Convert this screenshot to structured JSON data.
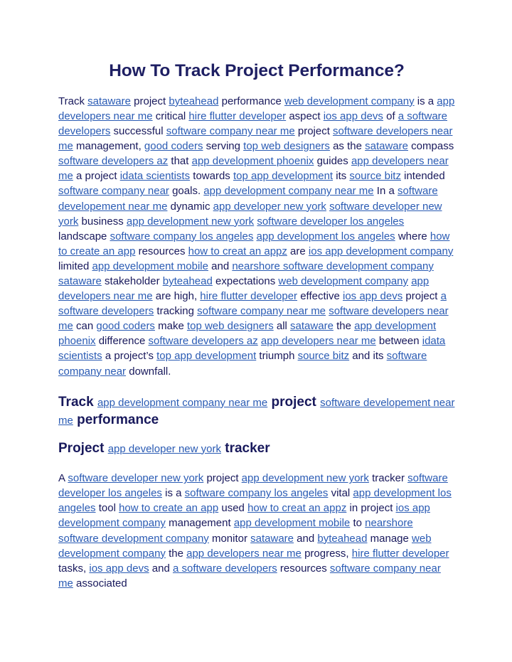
{
  "document": {
    "title": "How To Track Project Performance?",
    "colors": {
      "title": "#1e1f63",
      "body_text": "#18195c",
      "link": "#2a5bb4",
      "background": "#ffffff"
    },
    "paragraph_1": [
      {
        "t": "text",
        "v": "Track "
      },
      {
        "t": "link",
        "v": "sataware"
      },
      {
        "t": "text",
        "v": " project "
      },
      {
        "t": "link",
        "v": "byteahead"
      },
      {
        "t": "text",
        "v": " performance "
      },
      {
        "t": "link",
        "v": "web development company"
      },
      {
        "t": "text",
        "v": " is a "
      },
      {
        "t": "link",
        "v": "app developers near me"
      },
      {
        "t": "text",
        "v": " critical "
      },
      {
        "t": "link",
        "v": "hire flutter developer"
      },
      {
        "t": "text",
        "v": " aspect "
      },
      {
        "t": "link",
        "v": "ios app devs"
      },
      {
        "t": "text",
        "v": " of "
      },
      {
        "t": "link",
        "v": "a software developers"
      },
      {
        "t": "text",
        "v": " successful "
      },
      {
        "t": "link",
        "v": "software company near me"
      },
      {
        "t": "text",
        "v": " project "
      },
      {
        "t": "link",
        "v": "software developers near me"
      },
      {
        "t": "text",
        "v": " management, "
      },
      {
        "t": "link",
        "v": "good coders"
      },
      {
        "t": "text",
        "v": " serving "
      },
      {
        "t": "link",
        "v": "top web designers"
      },
      {
        "t": "text",
        "v": " as the "
      },
      {
        "t": "link",
        "v": "sataware"
      },
      {
        "t": "text",
        "v": " compass "
      },
      {
        "t": "link",
        "v": "software developers az"
      },
      {
        "t": "text",
        "v": " that "
      },
      {
        "t": "link",
        "v": "app development phoenix"
      },
      {
        "t": "text",
        "v": " guides "
      },
      {
        "t": "link",
        "v": "app developers near me"
      },
      {
        "t": "text",
        "v": " a project "
      },
      {
        "t": "link",
        "v": "idata scientists"
      },
      {
        "t": "text",
        "v": " towards "
      },
      {
        "t": "link",
        "v": "top app development"
      },
      {
        "t": "text",
        "v": " its "
      },
      {
        "t": "link",
        "v": "source bitz"
      },
      {
        "t": "text",
        "v": " intended "
      },
      {
        "t": "link",
        "v": "software company near"
      },
      {
        "t": "text",
        "v": " goals. "
      },
      {
        "t": "link",
        "v": "app development company near me"
      },
      {
        "t": "text",
        "v": " In a "
      },
      {
        "t": "link",
        "v": "software developement near me"
      },
      {
        "t": "text",
        "v": " dynamic "
      },
      {
        "t": "link",
        "v": "app developer new york"
      },
      {
        "t": "text",
        "v": " "
      },
      {
        "t": "link",
        "v": "software developer new york"
      },
      {
        "t": "text",
        "v": " business "
      },
      {
        "t": "link",
        "v": "app development new york"
      },
      {
        "t": "text",
        "v": " "
      },
      {
        "t": "link",
        "v": "software developer los angeles"
      },
      {
        "t": "text",
        "v": " landscape "
      },
      {
        "t": "link",
        "v": "software company los angeles"
      },
      {
        "t": "text",
        "v": " "
      },
      {
        "t": "link",
        "v": "app development los angeles"
      },
      {
        "t": "text",
        "v": " where "
      },
      {
        "t": "link",
        "v": "how to create an app"
      },
      {
        "t": "text",
        "v": " resources "
      },
      {
        "t": "link",
        "v": "how to creat an appz"
      },
      {
        "t": "text",
        "v": " are "
      },
      {
        "t": "link",
        "v": "ios app development company"
      },
      {
        "t": "text",
        "v": " limited "
      },
      {
        "t": "link",
        "v": "app development mobile"
      },
      {
        "t": "text",
        "v": " and "
      },
      {
        "t": "link",
        "v": "nearshore software development company"
      },
      {
        "t": "text",
        "v": " "
      },
      {
        "t": "link",
        "v": "sataware"
      },
      {
        "t": "text",
        "v": " stakeholder "
      },
      {
        "t": "link",
        "v": "byteahead"
      },
      {
        "t": "text",
        "v": " expectations "
      },
      {
        "t": "link",
        "v": "web development company"
      },
      {
        "t": "text",
        "v": " "
      },
      {
        "t": "link",
        "v": "app developers near me"
      },
      {
        "t": "text",
        "v": " are high, "
      },
      {
        "t": "link",
        "v": "hire flutter developer"
      },
      {
        "t": "text",
        "v": " effective "
      },
      {
        "t": "link",
        "v": "ios app devs"
      },
      {
        "t": "text",
        "v": " project "
      },
      {
        "t": "link",
        "v": "a software developers"
      },
      {
        "t": "text",
        "v": " tracking "
      },
      {
        "t": "link",
        "v": "software company near me"
      },
      {
        "t": "text",
        "v": " "
      },
      {
        "t": "link",
        "v": "software developers near me"
      },
      {
        "t": "text",
        "v": " can "
      },
      {
        "t": "link",
        "v": "good coders"
      },
      {
        "t": "text",
        "v": " make "
      },
      {
        "t": "link",
        "v": "top web designers"
      },
      {
        "t": "text",
        "v": " all "
      },
      {
        "t": "link",
        "v": "sataware"
      },
      {
        "t": "text",
        "v": " the "
      },
      {
        "t": "link",
        "v": "app development phoenix"
      },
      {
        "t": "text",
        "v": " difference "
      },
      {
        "t": "link",
        "v": "software developers az"
      },
      {
        "t": "text",
        "v": " "
      },
      {
        "t": "link",
        "v": "app developers near me"
      },
      {
        "t": "text",
        "v": " between "
      },
      {
        "t": "link",
        "v": "idata scientists"
      },
      {
        "t": "text",
        "v": " a project’s "
      },
      {
        "t": "link",
        "v": "top app development"
      },
      {
        "t": "text",
        "v": " triumph "
      },
      {
        "t": "link",
        "v": "source bitz"
      },
      {
        "t": "text",
        "v": " and its "
      },
      {
        "t": "link",
        "v": "software company near"
      },
      {
        "t": "text",
        "v": " downfall."
      }
    ],
    "heading_2": [
      {
        "t": "text",
        "v": "Track "
      },
      {
        "t": "link",
        "v": "app development company near me"
      },
      {
        "t": "text",
        "v": " project "
      },
      {
        "t": "link",
        "v": "software developement near me"
      },
      {
        "t": "text",
        "v": " performance"
      }
    ],
    "heading_3": [
      {
        "t": "text",
        "v": "Project "
      },
      {
        "t": "link",
        "v": "app developer new york"
      },
      {
        "t": "text",
        "v": " tracker"
      }
    ],
    "paragraph_2": [
      {
        "t": "text",
        "v": "A "
      },
      {
        "t": "link",
        "v": "software developer new york"
      },
      {
        "t": "text",
        "v": " project "
      },
      {
        "t": "link",
        "v": "app development new york"
      },
      {
        "t": "text",
        "v": " tracker "
      },
      {
        "t": "link",
        "v": "software developer los angeles"
      },
      {
        "t": "text",
        "v": " is a "
      },
      {
        "t": "link",
        "v": "software company los angeles"
      },
      {
        "t": "text",
        "v": " vital "
      },
      {
        "t": "link",
        "v": "app development los angeles"
      },
      {
        "t": "text",
        "v": " tool "
      },
      {
        "t": "link",
        "v": "how to create an app"
      },
      {
        "t": "text",
        "v": " used "
      },
      {
        "t": "link",
        "v": "how to creat an appz"
      },
      {
        "t": "text",
        "v": " in project "
      },
      {
        "t": "link",
        "v": "ios app development company"
      },
      {
        "t": "text",
        "v": " management "
      },
      {
        "t": "link",
        "v": "app development mobile"
      },
      {
        "t": "text",
        "v": " to "
      },
      {
        "t": "link",
        "v": "nearshore software development company"
      },
      {
        "t": "text",
        "v": " monitor "
      },
      {
        "t": "link",
        "v": "sataware"
      },
      {
        "t": "text",
        "v": " and "
      },
      {
        "t": "link",
        "v": "byteahead"
      },
      {
        "t": "text",
        "v": " manage "
      },
      {
        "t": "link",
        "v": "web development company"
      },
      {
        "t": "text",
        "v": " the "
      },
      {
        "t": "link",
        "v": "app developers near me"
      },
      {
        "t": "text",
        "v": " progress, "
      },
      {
        "t": "link",
        "v": "hire flutter developer"
      },
      {
        "t": "text",
        "v": " tasks, "
      },
      {
        "t": "link",
        "v": "ios app devs"
      },
      {
        "t": "text",
        "v": " and "
      },
      {
        "t": "link",
        "v": "a software developers"
      },
      {
        "t": "text",
        "v": " resources "
      },
      {
        "t": "link",
        "v": "software company near me"
      },
      {
        "t": "text",
        "v": " associated"
      }
    ]
  }
}
